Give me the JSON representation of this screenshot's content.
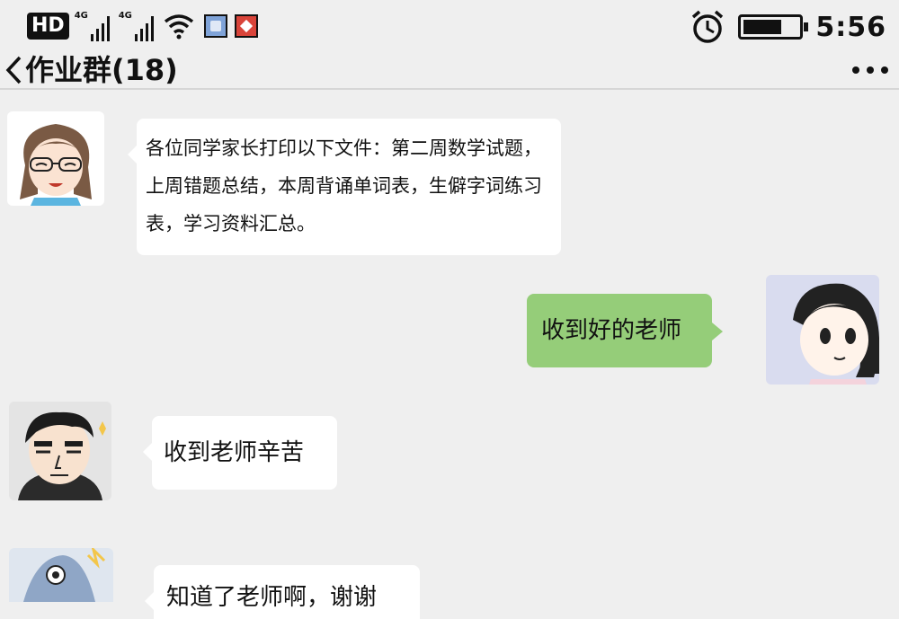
{
  "status_bar": {
    "hd_label": "HD",
    "network_1": "4G",
    "network_2": "4G",
    "time": "5:56",
    "battery_level": 0.7
  },
  "header": {
    "title": "作业群(18)"
  },
  "messages": [
    {
      "side": "left",
      "text": "各位同学家长打印以下文件：第二周数学试题，上周错题总结，本周背诵单词表，生僻字词练习表，学习资料汇总。"
    },
    {
      "side": "right",
      "text": "收到好的老师"
    },
    {
      "side": "left",
      "text": "收到老师辛苦"
    },
    {
      "side": "left",
      "text": "知道了老师啊，谢谢"
    }
  ],
  "colors": {
    "background": "#efefef",
    "outgoing_bubble": "#95cd79",
    "incoming_bubble": "#ffffff"
  }
}
